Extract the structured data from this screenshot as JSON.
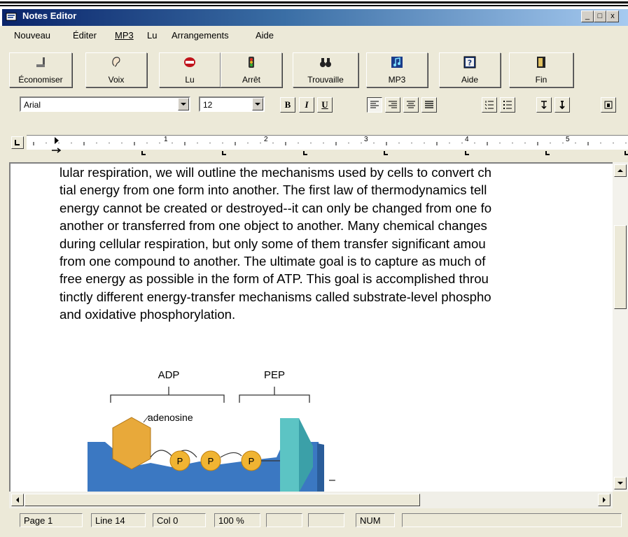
{
  "window": {
    "title": "Notes Editor",
    "min": "_",
    "max": "□",
    "close": "x"
  },
  "menu": [
    "Nouveau",
    "Éditer",
    "MP3",
    "Lu",
    "Arrangements",
    "Aide"
  ],
  "toolbar": [
    {
      "label": "Économiser",
      "icon": "save-icon"
    },
    {
      "label": "Voix",
      "icon": "ear-icon"
    },
    {
      "label": "Lu",
      "icon": "mouth-icon"
    },
    {
      "label": "Arrêt",
      "icon": "traffic-light-icon"
    },
    {
      "label": "Trouvaille",
      "icon": "binoculars-icon"
    },
    {
      "label": "MP3",
      "icon": "music-note-icon"
    },
    {
      "label": "Aide",
      "icon": "help-icon"
    },
    {
      "label": "Fin",
      "icon": "door-icon"
    }
  ],
  "format": {
    "font": "Arial",
    "size": "12",
    "bold": "B",
    "italic": "I",
    "underline": "U"
  },
  "ruler": {
    "marks": [
      "1",
      "2",
      "3",
      "4",
      "5"
    ]
  },
  "document": {
    "lines": [
      "lular respiration, we will outline the mechanisms used by cells to convert ch",
      "tial energy from one form into another. The first law of thermodynamics tell",
      "energy cannot be created or destroyed--it can only be changed from one fo",
      "another or transferred from one object to another. Many chemical changes",
      "during cellular respiration, but only some of them transfer significant amou",
      "from one compound to another. The ultimate goal is to capture as much of",
      "free energy as possible in the form of ATP. This goal is accomplished throu",
      "tinctly different energy-transfer mechanisms called substrate-level phospho",
      "and oxidative phosphorylation."
    ],
    "figure": {
      "label_adp": "ADP",
      "label_pep": "PEP",
      "label_adenosine": "adenosine",
      "phosphate": "P",
      "minus": "–"
    }
  },
  "status": {
    "page": "Page  1",
    "line": "Line 14",
    "col": "Col  0",
    "zoom": "100 %",
    "num": "NUM"
  },
  "colors": {
    "title_start": "#0a246a",
    "title_end": "#a6caf0",
    "membrane": "#3b78c2",
    "adenosine": "#e8a93a",
    "phosphate": "#f0b432",
    "pep": "#5cc4c4"
  }
}
